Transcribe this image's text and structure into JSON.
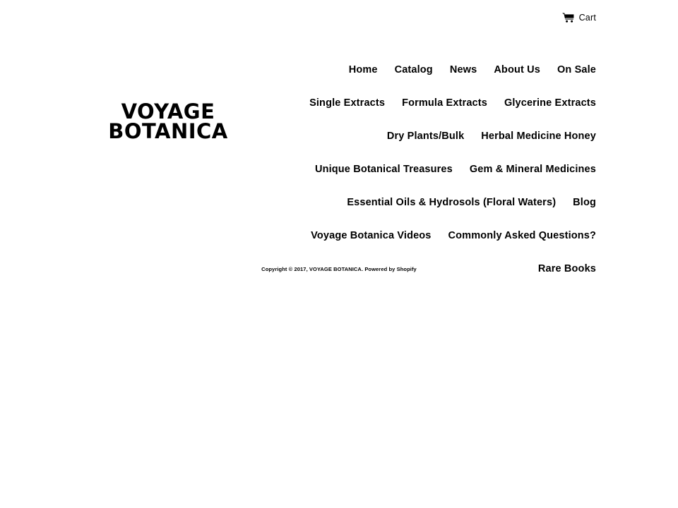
{
  "site": {
    "logo_line1": "VOYAGE",
    "logo_line2": "BOTANICA",
    "text_color": "#000000",
    "background_color": "#ffffff"
  },
  "utility": {
    "cart_icon": "shopping-cart-icon",
    "cart_label": "Cart"
  },
  "nav": {
    "items": [
      {
        "label": "Home"
      },
      {
        "label": "Catalog"
      },
      {
        "label": "News"
      },
      {
        "label": "About Us"
      },
      {
        "label": "On Sale"
      },
      {
        "label": "Single Extracts"
      },
      {
        "label": "Formula Extracts"
      },
      {
        "label": "Glycerine Extracts"
      },
      {
        "label": "Dry Plants/Bulk"
      },
      {
        "label": "Herbal Medicine Honey"
      },
      {
        "label": "Unique Botanical Treasures"
      },
      {
        "label": "Gem & Mineral Medicines"
      },
      {
        "label": "Essential Oils & Hydrosols (Floral Waters)"
      },
      {
        "label": "Blog"
      },
      {
        "label": "Voyage Botanica Videos"
      },
      {
        "label": "Commonly Asked Questions?"
      },
      {
        "label": "Rare Books"
      }
    ]
  },
  "footer": {
    "copyright_prefix": "Copyright © 2017, VOYAGE BOTANICA.",
    "powered_by_prefix": "Powered by",
    "powered_by_link": "Shopify"
  }
}
